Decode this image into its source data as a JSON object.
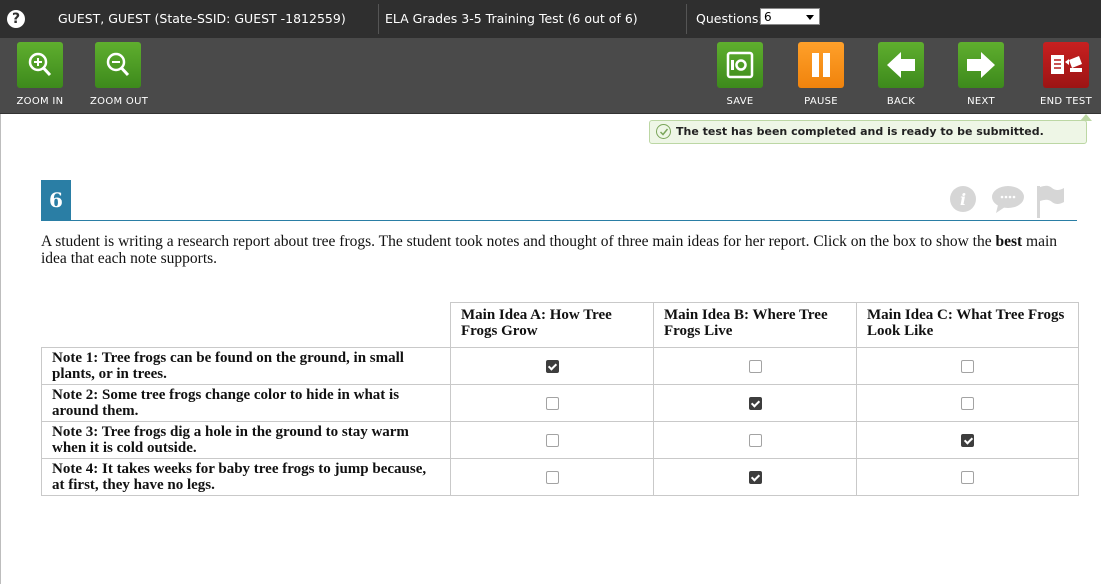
{
  "topbar": {
    "help_icon": "question-circle-icon",
    "user_info": "GUEST, GUEST (State-SSID: GUEST -1812559)",
    "test_name": "ELA Grades 3-5 Training Test (6 out of 6)",
    "questions_label": "Questions:",
    "questions_selected": "6"
  },
  "toolbar": {
    "zoom_in": "ZOOM IN",
    "zoom_out": "ZOOM OUT",
    "save": "SAVE",
    "pause": "PAUSE",
    "back": "BACK",
    "next": "NEXT",
    "end_test": "END TEST"
  },
  "notice": {
    "text": "The test has been completed and is ready to be submitted."
  },
  "question": {
    "number": "6",
    "stem_before": "A student is writing a research report about tree frogs. The student took notes and thought of three main ideas for her report. Click on the box to show the ",
    "stem_bold": "best",
    "stem_after": " main idea that each note supports.",
    "icons": [
      "info-icon",
      "comment-icon",
      "flag-icon"
    ]
  },
  "grid": {
    "columns": [
      "Main Idea A: How Tree Frogs Grow",
      "Main Idea B: Where Tree Frogs Live",
      "Main Idea C: What Tree Frogs Look Like"
    ],
    "rows": [
      {
        "note": "Note 1: Tree frogs can be found on the ground, in small plants, or in trees.",
        "checked": [
          true,
          false,
          false
        ]
      },
      {
        "note": "Note 2: Some tree frogs change color to hide in what is around them.",
        "checked": [
          false,
          true,
          false
        ]
      },
      {
        "note": "Note 3: Tree frogs dig a hole in the ground to stay warm when it is cold outside.",
        "checked": [
          false,
          false,
          true
        ]
      },
      {
        "note": "Note 4: It takes weeks for baby tree frogs to jump because, at first, they have no legs.",
        "checked": [
          false,
          true,
          false
        ]
      }
    ]
  },
  "colors": {
    "topbar_bg": "#2f2f2f",
    "toolbar_bg": "#4a4a4a",
    "green_button": "#4f9e25",
    "orange_button": "#f7931e",
    "red_button": "#b51a1a",
    "question_accent": "#2a7ea5"
  }
}
